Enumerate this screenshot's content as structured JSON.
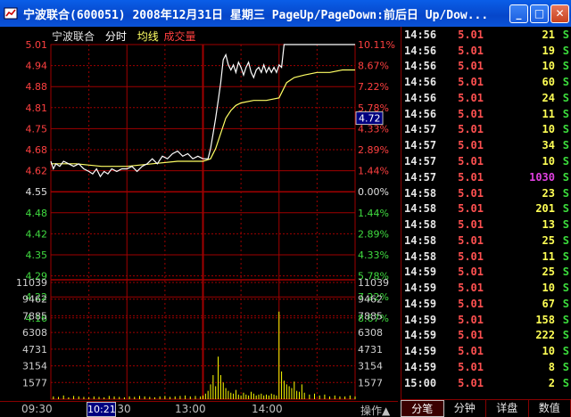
{
  "window": {
    "title": "宁波联合(600051) 2008年12月31日 星期三 PageUp/PageDown:前后日 Up/Dow...",
    "minimize_label": "_",
    "maximize_label": "□",
    "close_label": "✕"
  },
  "chart_header": {
    "name": "宁波联合",
    "mode": "分时",
    "avg": "均线",
    "volume": "成交量"
  },
  "price_axis": {
    "left_labels": [
      "5.01",
      "4.94",
      "4.88",
      "4.81",
      "4.75",
      "4.68",
      "4.62",
      "4.55",
      "4.48",
      "4.42",
      "4.35",
      "4.29",
      "4.22",
      "4.16"
    ],
    "right_labels": [
      "10.11%",
      "8.67%",
      "7.22%",
      "5.78%",
      "4.33%",
      "2.89%",
      "1.44%",
      "0.00%",
      "1.44%",
      "2.89%",
      "4.33%",
      "5.78%",
      "7.22%",
      "8.67%"
    ],
    "cursor_price": "4.72"
  },
  "volume_axis": {
    "labels": [
      "11039",
      "9462",
      "7885",
      "6308",
      "4731",
      "3154",
      "1577"
    ]
  },
  "time_axis": {
    "labels": [
      "09:30",
      "10:30",
      "13:00",
      "14:00"
    ],
    "cursor_time": "10:21"
  },
  "action_button": "操作▲",
  "colors": {
    "grid": "#a00000",
    "price_line": "#ffffff",
    "avg_line": "#ffff64",
    "up": "#ff4040",
    "down": "#40dc40",
    "flat": "#e0e0e0",
    "volume": "#ffff00"
  },
  "chart_data": {
    "type": "line",
    "prev_close": 4.55,
    "ylim": [
      4.09,
      5.01
    ],
    "x_range_minutes": [
      0,
      240
    ],
    "price_series": [
      [
        0,
        4.55
      ],
      [
        2,
        4.52
      ],
      [
        4,
        4.54
      ],
      [
        7,
        4.53
      ],
      [
        10,
        4.55
      ],
      [
        14,
        4.54
      ],
      [
        18,
        4.53
      ],
      [
        22,
        4.54
      ],
      [
        26,
        4.52
      ],
      [
        30,
        4.51
      ],
      [
        33,
        4.5
      ],
      [
        36,
        4.52
      ],
      [
        39,
        4.49
      ],
      [
        42,
        4.51
      ],
      [
        45,
        4.5
      ],
      [
        48,
        4.52
      ],
      [
        52,
        4.51
      ],
      [
        56,
        4.52
      ],
      [
        60,
        4.52
      ],
      [
        64,
        4.53
      ],
      [
        68,
        4.51
      ],
      [
        72,
        4.53
      ],
      [
        76,
        4.54
      ],
      [
        80,
        4.56
      ],
      [
        84,
        4.54
      ],
      [
        88,
        4.57
      ],
      [
        92,
        4.56
      ],
      [
        96,
        4.58
      ],
      [
        100,
        4.59
      ],
      [
        104,
        4.57
      ],
      [
        108,
        4.58
      ],
      [
        112,
        4.56
      ],
      [
        116,
        4.57
      ],
      [
        120,
        4.56
      ],
      [
        124,
        4.56
      ],
      [
        126,
        4.6
      ],
      [
        128,
        4.66
      ],
      [
        130,
        4.72
      ],
      [
        132,
        4.79
      ],
      [
        134,
        4.86
      ],
      [
        136,
        4.95
      ],
      [
        138,
        4.97
      ],
      [
        140,
        4.93
      ],
      [
        142,
        4.91
      ],
      [
        144,
        4.93
      ],
      [
        146,
        4.9
      ],
      [
        148,
        4.94
      ],
      [
        150,
        4.92
      ],
      [
        152,
        4.89
      ],
      [
        154,
        4.92
      ],
      [
        156,
        4.94
      ],
      [
        158,
        4.9
      ],
      [
        160,
        4.88
      ],
      [
        162,
        4.91
      ],
      [
        164,
        4.92
      ],
      [
        166,
        4.9
      ],
      [
        168,
        4.93
      ],
      [
        170,
        4.9
      ],
      [
        172,
        4.92
      ],
      [
        174,
        4.9
      ],
      [
        176,
        4.92
      ],
      [
        178,
        4.9
      ],
      [
        180,
        4.93
      ],
      [
        182,
        4.92
      ],
      [
        184,
        5.01
      ],
      [
        190,
        5.01
      ],
      [
        200,
        5.01
      ],
      [
        210,
        5.01
      ],
      [
        220,
        5.01
      ],
      [
        230,
        5.01
      ],
      [
        240,
        5.01
      ]
    ],
    "avg_series": [
      [
        0,
        4.54
      ],
      [
        20,
        4.54
      ],
      [
        40,
        4.53
      ],
      [
        60,
        4.53
      ],
      [
        80,
        4.54
      ],
      [
        100,
        4.55
      ],
      [
        120,
        4.55
      ],
      [
        126,
        4.56
      ],
      [
        130,
        4.6
      ],
      [
        134,
        4.66
      ],
      [
        138,
        4.72
      ],
      [
        142,
        4.75
      ],
      [
        146,
        4.77
      ],
      [
        150,
        4.78
      ],
      [
        160,
        4.79
      ],
      [
        170,
        4.79
      ],
      [
        180,
        4.8
      ],
      [
        186,
        4.86
      ],
      [
        192,
        4.88
      ],
      [
        200,
        4.89
      ],
      [
        210,
        4.9
      ],
      [
        220,
        4.9
      ],
      [
        230,
        4.91
      ],
      [
        240,
        4.91
      ]
    ],
    "volume_series": [
      [
        2,
        300
      ],
      [
        6,
        250
      ],
      [
        10,
        400
      ],
      [
        14,
        200
      ],
      [
        18,
        350
      ],
      [
        22,
        300
      ],
      [
        26,
        250
      ],
      [
        30,
        200
      ],
      [
        34,
        300
      ],
      [
        38,
        250
      ],
      [
        42,
        200
      ],
      [
        46,
        350
      ],
      [
        50,
        300
      ],
      [
        54,
        250
      ],
      [
        58,
        200
      ],
      [
        62,
        300
      ],
      [
        66,
        250
      ],
      [
        70,
        350
      ],
      [
        74,
        300
      ],
      [
        78,
        250
      ],
      [
        82,
        200
      ],
      [
        86,
        300
      ],
      [
        90,
        350
      ],
      [
        94,
        250
      ],
      [
        98,
        300
      ],
      [
        102,
        350
      ],
      [
        106,
        400
      ],
      [
        110,
        300
      ],
      [
        114,
        350
      ],
      [
        118,
        300
      ],
      [
        120,
        400
      ],
      [
        122,
        600
      ],
      [
        124,
        900
      ],
      [
        126,
        1600
      ],
      [
        128,
        2600
      ],
      [
        130,
        1400
      ],
      [
        132,
        4600
      ],
      [
        134,
        2600
      ],
      [
        136,
        1800
      ],
      [
        138,
        1200
      ],
      [
        140,
        900
      ],
      [
        142,
        700
      ],
      [
        144,
        600
      ],
      [
        146,
        1000
      ],
      [
        148,
        500
      ],
      [
        150,
        400
      ],
      [
        152,
        700
      ],
      [
        154,
        500
      ],
      [
        156,
        400
      ],
      [
        158,
        800
      ],
      [
        160,
        600
      ],
      [
        162,
        400
      ],
      [
        164,
        500
      ],
      [
        166,
        600
      ],
      [
        168,
        400
      ],
      [
        170,
        500
      ],
      [
        172,
        400
      ],
      [
        174,
        600
      ],
      [
        176,
        500
      ],
      [
        178,
        400
      ],
      [
        180,
        9462
      ],
      [
        182,
        3000
      ],
      [
        184,
        2000
      ],
      [
        186,
        1600
      ],
      [
        188,
        1400
      ],
      [
        190,
        1200
      ],
      [
        192,
        1900
      ],
      [
        194,
        900
      ],
      [
        196,
        800
      ],
      [
        198,
        1600
      ],
      [
        200,
        700
      ],
      [
        204,
        500
      ],
      [
        208,
        600
      ],
      [
        212,
        400
      ],
      [
        216,
        500
      ],
      [
        220,
        300
      ],
      [
        224,
        400
      ],
      [
        228,
        300
      ],
      [
        232,
        300
      ],
      [
        236,
        400
      ],
      [
        240,
        300
      ]
    ],
    "volume_ylim": [
      0,
      12616
    ]
  },
  "trades": [
    {
      "time": "14:56",
      "price": "5.01",
      "vol": "21",
      "dir": "S"
    },
    {
      "time": "14:56",
      "price": "5.01",
      "vol": "19",
      "dir": "S"
    },
    {
      "time": "14:56",
      "price": "5.01",
      "vol": "10",
      "dir": "S"
    },
    {
      "time": "14:56",
      "price": "5.01",
      "vol": "60",
      "dir": "S"
    },
    {
      "time": "14:56",
      "price": "5.01",
      "vol": "24",
      "dir": "S"
    },
    {
      "time": "14:56",
      "price": "5.01",
      "vol": "11",
      "dir": "S"
    },
    {
      "time": "14:57",
      "price": "5.01",
      "vol": "10",
      "dir": "S"
    },
    {
      "time": "14:57",
      "price": "5.01",
      "vol": "34",
      "dir": "S"
    },
    {
      "time": "14:57",
      "price": "5.01",
      "vol": "10",
      "dir": "S"
    },
    {
      "time": "14:57",
      "price": "5.01",
      "vol": "1030",
      "dir": "S"
    },
    {
      "time": "14:58",
      "price": "5.01",
      "vol": "23",
      "dir": "S"
    },
    {
      "time": "14:58",
      "price": "5.01",
      "vol": "201",
      "dir": "S"
    },
    {
      "time": "14:58",
      "price": "5.01",
      "vol": "13",
      "dir": "S"
    },
    {
      "time": "14:58",
      "price": "5.01",
      "vol": "25",
      "dir": "S"
    },
    {
      "time": "14:58",
      "price": "5.01",
      "vol": "11",
      "dir": "S"
    },
    {
      "time": "14:59",
      "price": "5.01",
      "vol": "25",
      "dir": "S"
    },
    {
      "time": "14:59",
      "price": "5.01",
      "vol": "10",
      "dir": "S"
    },
    {
      "time": "14:59",
      "price": "5.01",
      "vol": "67",
      "dir": "S"
    },
    {
      "time": "14:59",
      "price": "5.01",
      "vol": "158",
      "dir": "S"
    },
    {
      "time": "14:59",
      "price": "5.01",
      "vol": "222",
      "dir": "S"
    },
    {
      "time": "14:59",
      "price": "5.01",
      "vol": "10",
      "dir": "S"
    },
    {
      "time": "14:59",
      "price": "5.01",
      "vol": "8",
      "dir": "S"
    },
    {
      "time": "15:00",
      "price": "5.01",
      "vol": "2",
      "dir": "S"
    }
  ],
  "tabs": [
    {
      "label": "分笔",
      "active": true
    },
    {
      "label": "分钟",
      "active": false
    },
    {
      "label": "详盘",
      "active": false
    },
    {
      "label": "数值",
      "active": false
    }
  ]
}
